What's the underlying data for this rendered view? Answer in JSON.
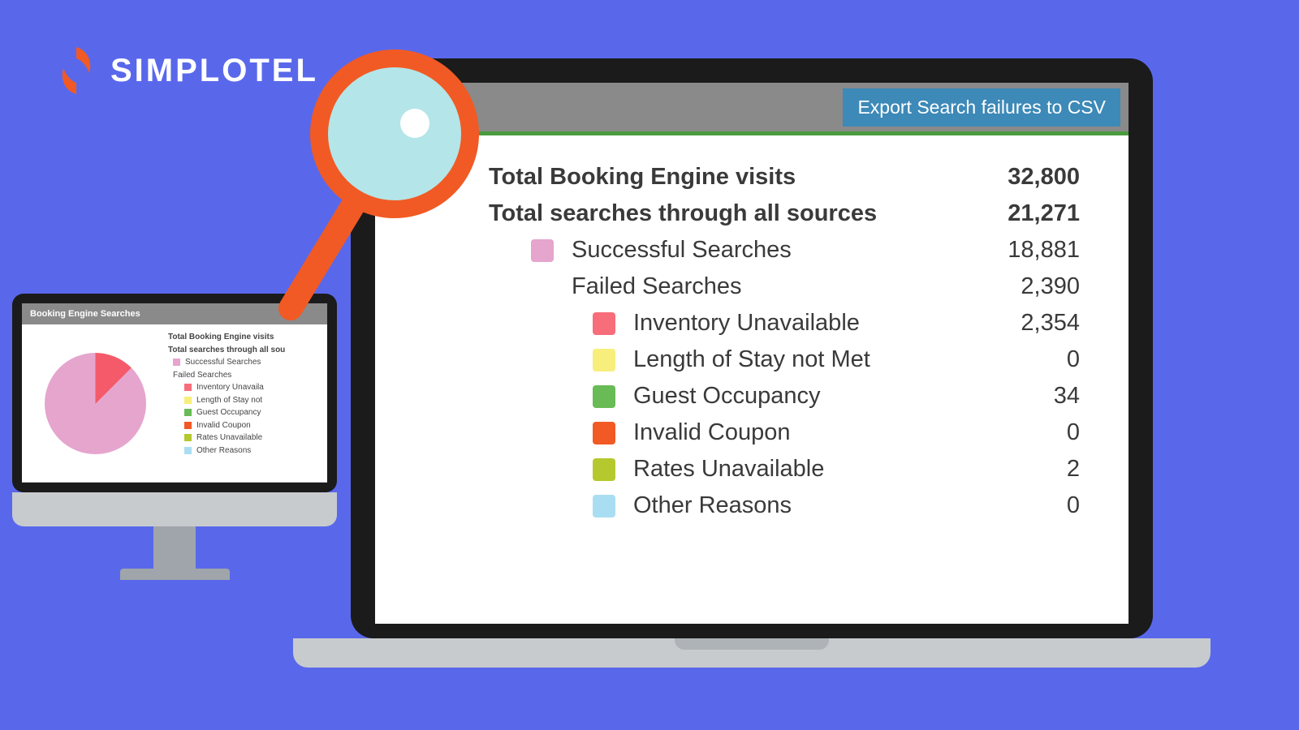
{
  "brand": {
    "name": "SIMPLOTEL"
  },
  "laptop": {
    "export_button_label": "Export Search failures to CSV",
    "stats": {
      "total_visits_label": "Total Booking Engine visits",
      "total_visits_value": "32,800",
      "total_searches_label": "Total searches through all sources",
      "total_searches_value": "21,271",
      "successful_label": "Successful Searches",
      "successful_value": "18,881",
      "successful_color": "#e5a5cd",
      "failed_label": "Failed Searches",
      "failed_value": "2,390",
      "reasons": [
        {
          "label": "Inventory Unavailable",
          "value": "2,354",
          "color": "#f76d7a"
        },
        {
          "label": "Length of Stay not Met",
          "value": "0",
          "color": "#f7ee7c"
        },
        {
          "label": "Guest Occupancy",
          "value": "34",
          "color": "#68bb55"
        },
        {
          "label": "Invalid Coupon",
          "value": "0",
          "color": "#f15a24"
        },
        {
          "label": "Rates Unavailable",
          "value": "2",
          "color": "#b5c92e"
        },
        {
          "label": "Other Reasons",
          "value": "0",
          "color": "#a9def2"
        }
      ]
    }
  },
  "imac": {
    "header_title": "Booking Engine Searches",
    "legend": {
      "total_visits_label": "Total Booking Engine visits",
      "total_searches_label": "Total searches through all sou",
      "successful_label": "Successful Searches",
      "successful_color": "#e5a5cd",
      "failed_label": "Failed Searches",
      "reasons": [
        {
          "label": "Inventory Unavaila",
          "color": "#f76d7a"
        },
        {
          "label": "Length of Stay not",
          "color": "#f7ee7c"
        },
        {
          "label": "Guest Occupancy",
          "color": "#68bb55"
        },
        {
          "label": "Invalid Coupon",
          "color": "#f15a24"
        },
        {
          "label": "Rates Unavailable",
          "color": "#b5c92e"
        },
        {
          "label": "Other Reasons",
          "color": "#a9def2"
        }
      ]
    }
  },
  "chart_data": {
    "type": "pie",
    "title": "Booking Engine Searches",
    "series": [
      {
        "name": "Successful Searches",
        "value": 18881,
        "color": "#e5a5cd"
      },
      {
        "name": "Failed Searches",
        "value": 2390,
        "color": "#f55a6a"
      }
    ],
    "failure_breakdown": [
      {
        "name": "Inventory Unavailable",
        "value": 2354
      },
      {
        "name": "Length of Stay not Met",
        "value": 0
      },
      {
        "name": "Guest Occupancy",
        "value": 34
      },
      {
        "name": "Invalid Coupon",
        "value": 0
      },
      {
        "name": "Rates Unavailable",
        "value": 2
      },
      {
        "name": "Other Reasons",
        "value": 0
      }
    ]
  }
}
